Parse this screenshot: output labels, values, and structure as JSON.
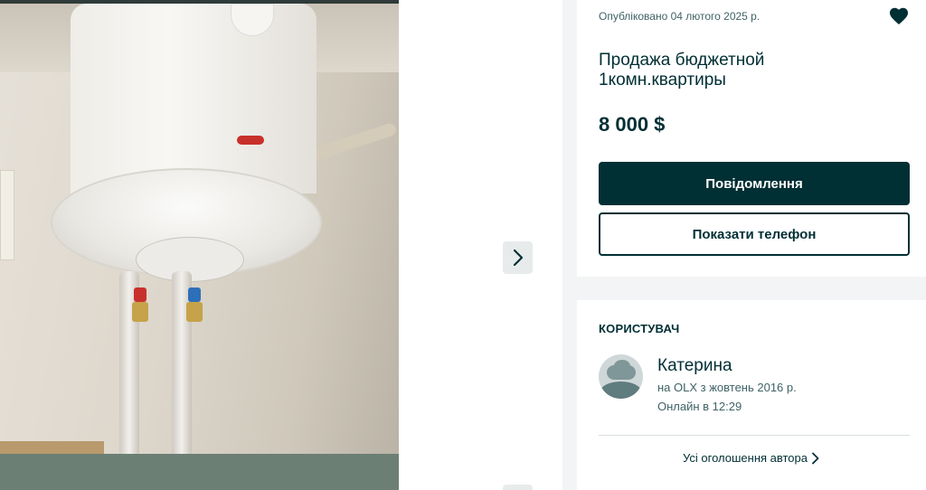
{
  "gallery": {
    "photo_alt": "",
    "next_icon": "chevron-right-icon"
  },
  "ad": {
    "published": "Опубліковано 04 лютого 2025 р.",
    "favorite_icon": "heart-icon",
    "title": "Продажа бюджетной 1комн.квартиры",
    "price": "8 000 $",
    "message_button": "Повідомлення",
    "phone_button": "Показати телефон"
  },
  "user": {
    "heading": "КОРИСТУВАЧ",
    "name": "Катерина",
    "since": "на OLX з жовтень 2016 р.",
    "online": "Онлайн в 12:29",
    "all_ads_link": "Усі оголошення автора"
  },
  "colors": {
    "brand_dark": "#002f34",
    "muted_text": "#406367",
    "page_bg": "#f2f4f5"
  }
}
